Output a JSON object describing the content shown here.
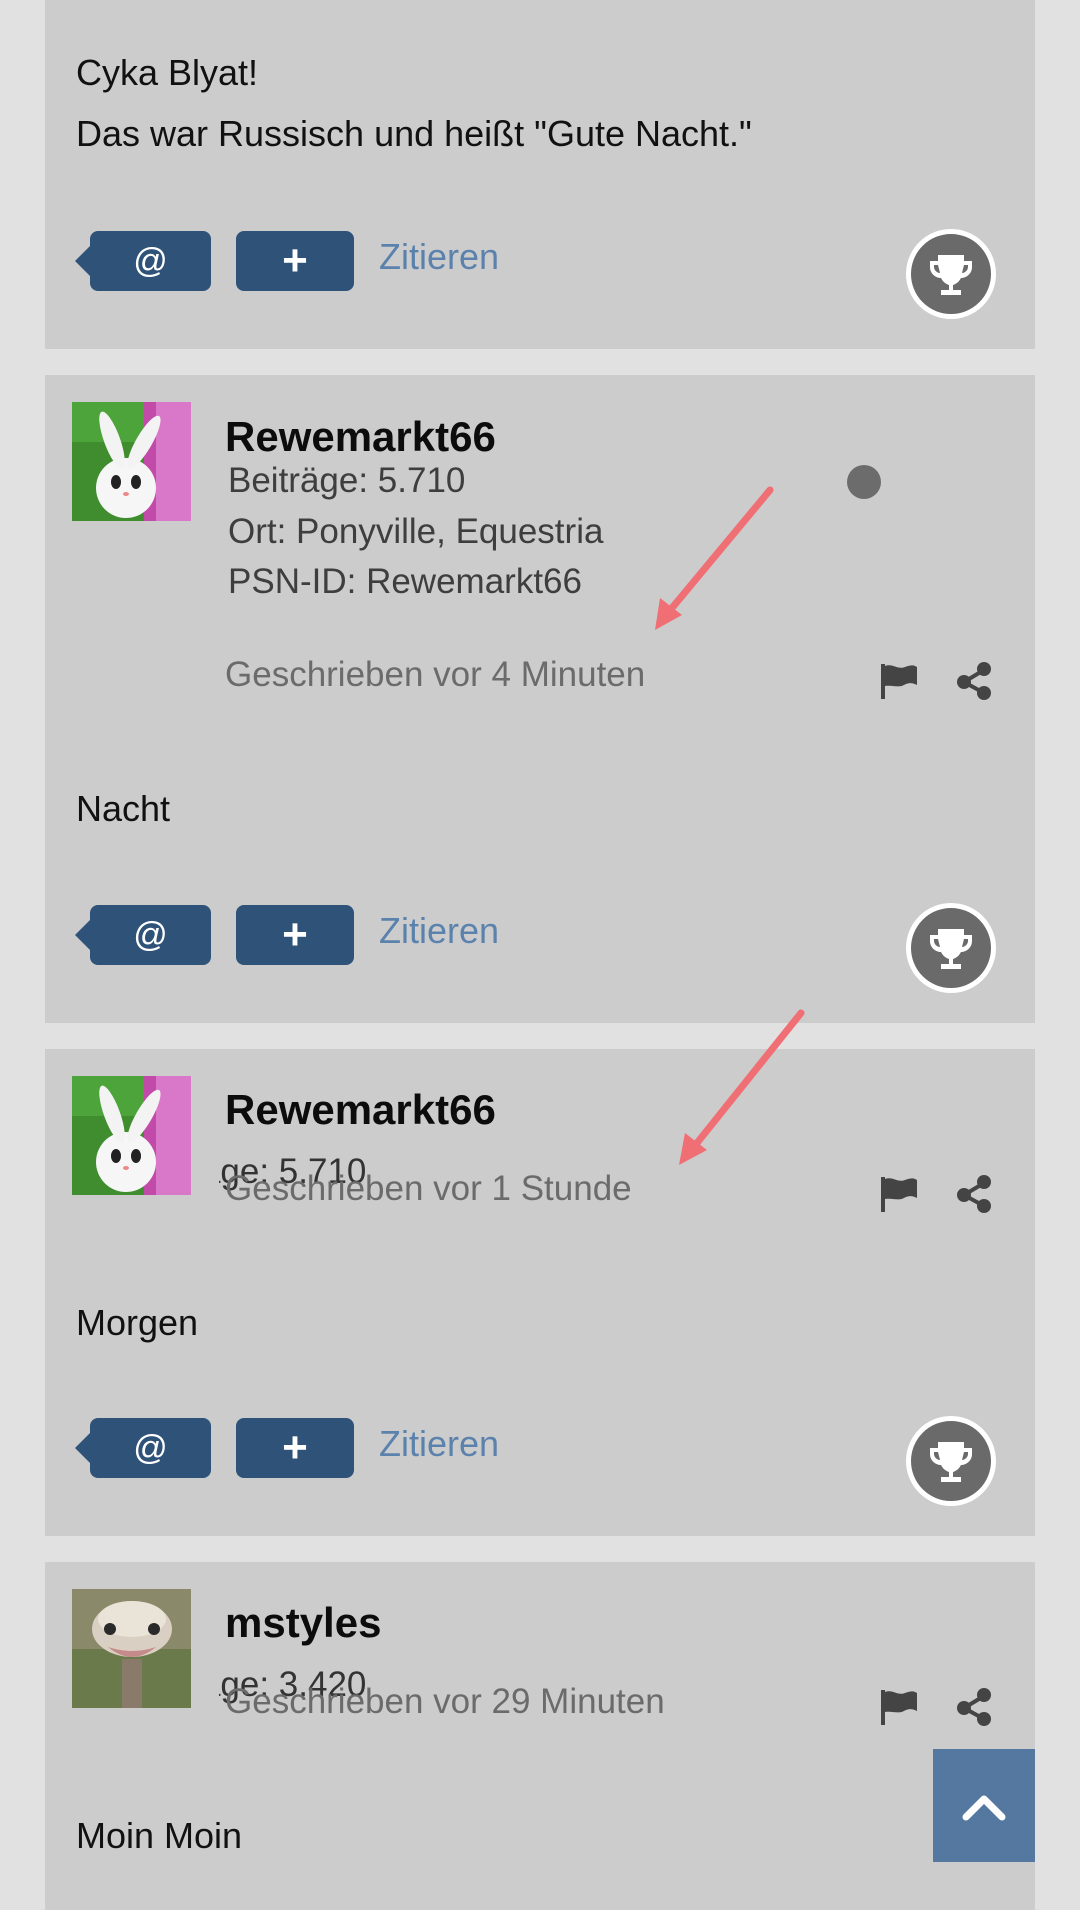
{
  "posts": [
    {
      "author": "",
      "lines": [
        "Cyka Blyat!",
        "Das war Russisch und heißt \"Gute Nacht.\""
      ]
    },
    {
      "author": "Rewemarkt66",
      "stats": [
        "Beiträge: 5.710",
        "Ort: Ponyville, Equestria",
        "PSN-ID: Rewemarkt66"
      ],
      "timestamp": "Geschrieben vor 4 Minuten",
      "text": "Nacht"
    },
    {
      "author": "Rewemarkt66",
      "stats_overlap": "Beiträge: 5.710",
      "timestamp": "Geschrieben vor 1 Stunde",
      "text": "Morgen"
    },
    {
      "author": "mstyles",
      "stats_overlap": "Beiträge: 3.420",
      "timestamp": "Geschrieben vor 29 Minuten",
      "text": "Moin Moin"
    }
  ],
  "actions": {
    "mention_label": "@",
    "plus_label": "+",
    "quote_label": "Zitieren"
  },
  "icons": {
    "trophy": "trophy-icon",
    "flag": "flag-icon",
    "share": "share-icon",
    "scroll_top": "chevron-up-icon",
    "online_status": "status-dot-icon"
  },
  "colors": {
    "page_bg": "#e1e1e1",
    "card_bg": "#cccccc",
    "button_bg": "#2f5279",
    "link": "#5b82ad",
    "scroll_top_bg": "#54789f",
    "annotation_arrow": "#ef6f75"
  }
}
